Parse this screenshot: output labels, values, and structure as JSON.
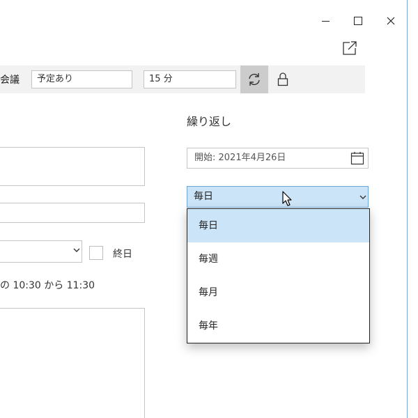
{
  "toolbar": {
    "meeting_label": "会議",
    "busy_status": "予定あり",
    "reminder": "15 分"
  },
  "event": {
    "all_day_label": "終日",
    "time_text": "の 10:30 から 11:30"
  },
  "recurrence": {
    "heading": "繰り返し",
    "start": "開始:  2021年4月26日",
    "frequency": "毎日",
    "options": [
      "毎日",
      "毎週",
      "毎月",
      "毎年"
    ],
    "selected_index": 0
  },
  "colors": {
    "selection": "#cce4f7",
    "toolbar_bg": "#f2f2f2",
    "active_button": "#cccccc"
  },
  "icons": [
    "minimize-icon",
    "maximize-icon",
    "close-icon",
    "popout-icon",
    "repeat-icon",
    "lock-icon",
    "calendar-icon",
    "chevron-down-icon",
    "mouse-cursor-icon"
  ]
}
